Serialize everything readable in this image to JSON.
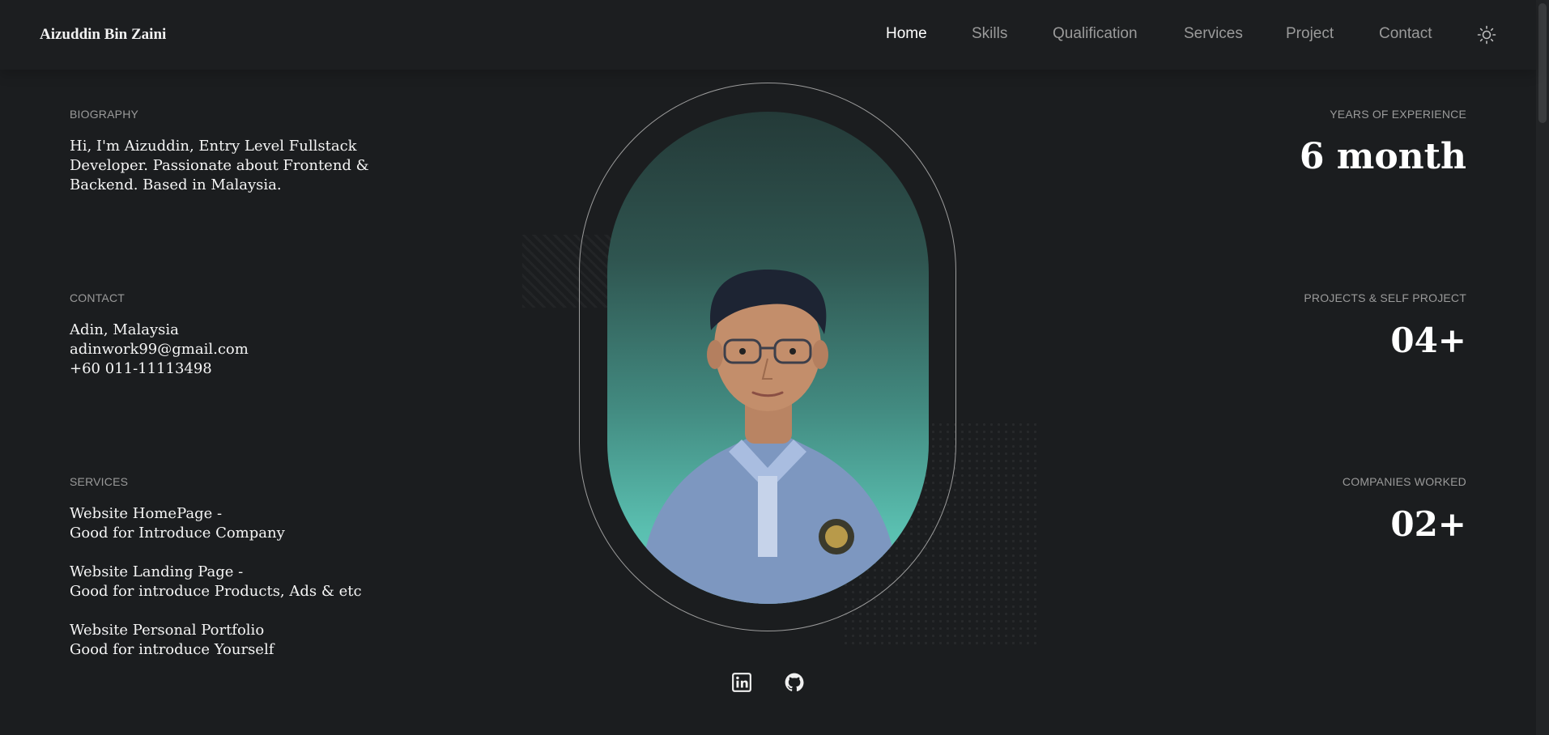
{
  "header": {
    "logo": "Aizuddin Bin Zaini",
    "nav": [
      "Home",
      "Skills",
      "Qualification",
      "Services",
      "Project",
      "Contact"
    ],
    "active_nav": "Home",
    "theme_icon": "sun-icon"
  },
  "left": {
    "biography": {
      "label": "BIOGRAPHY",
      "lines": [
        "Hi, I'm Aizuddin, Entry Level Fullstack",
        "Developer. Passionate about Frontend &",
        "Backend. Based in Malaysia."
      ]
    },
    "contact": {
      "label": "CONTACT",
      "location": "Adin, Malaysia",
      "email": "adinwork99@gmail.com",
      "phone": "+60 011-11113498"
    },
    "services": {
      "label": "SERVICES",
      "items": [
        {
          "title": "Website HomePage -",
          "desc": "Good for Introduce Company"
        },
        {
          "title": "Website Landing Page -",
          "desc": "Good for introduce Products, Ads & etc"
        },
        {
          "title": "Website Personal Portfolio",
          "desc": "Good for introduce Yourself"
        }
      ]
    }
  },
  "right": {
    "experience": {
      "label": "YEARS OF EXPERIENCE",
      "value": "6 month"
    },
    "projects": {
      "label": "PROJECTS & SELF PROJECT",
      "value": "04+"
    },
    "companies": {
      "label": "COMPANIES WORKED",
      "value": "02+"
    }
  },
  "social": [
    "linkedin-icon",
    "github-icon"
  ],
  "colors": {
    "background": "#1b1d1f",
    "accent": "#5abfb0",
    "muted": "#9a9a9a"
  }
}
